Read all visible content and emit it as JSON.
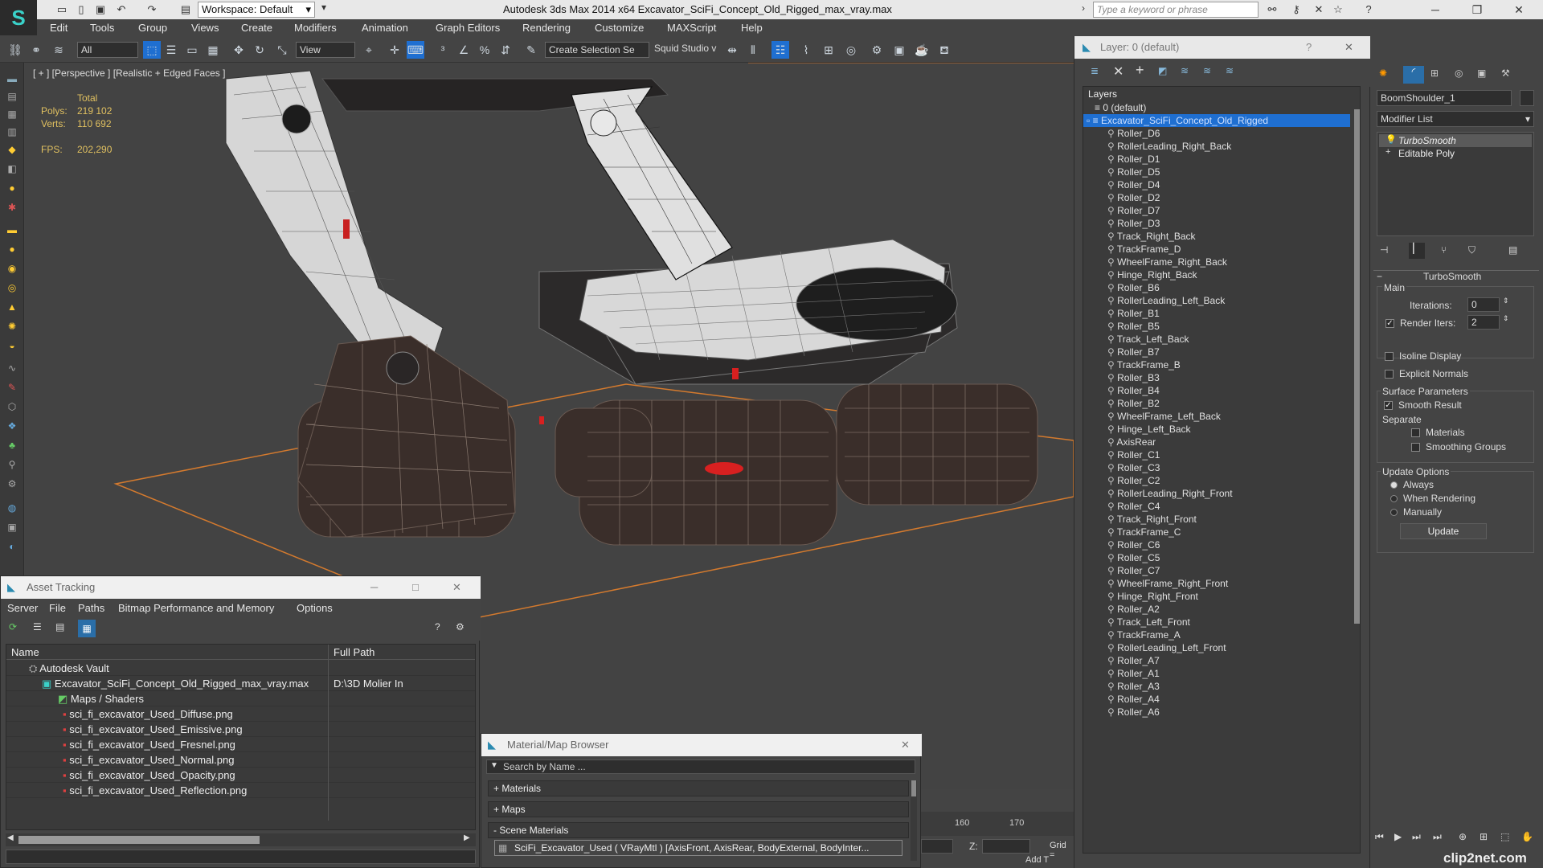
{
  "app": {
    "title": "Autodesk 3ds Max  2014 x64     Excavator_SciFi_Concept_Old_Rigged_max_vray.max",
    "logo_text": "S",
    "workspace": "Workspace: Default",
    "search_placeholder": "Type a keyword or phrase"
  },
  "menu": [
    "Edit",
    "Tools",
    "Group",
    "Views",
    "Create",
    "Modifiers",
    "Animation",
    "Graph Editors",
    "Rendering",
    "Customize",
    "MAXScript",
    "Help"
  ],
  "toolbar": {
    "selection_filter": "All",
    "ref_coord": "View",
    "selection_set_placeholder": "Create Selection Se",
    "squid_studio": "Squid Studio v"
  },
  "viewport": {
    "label": "[ + ] [Perspective ] [Realistic + Edged Faces ]",
    "stats_total": "Total",
    "polys_label": "Polys:",
    "polys_value": "219 102",
    "verts_label": "Verts:",
    "verts_value": "110 692",
    "fps_label": "FPS:",
    "fps_value": "202,290"
  },
  "layers": {
    "title": "Layer: 0 (default)",
    "header": "Layers",
    "default_layer": "0 (default)",
    "selected_layer": "Excavator_SciFi_Concept_Old_Rigged",
    "items": [
      "Roller_D6",
      "RollerLeading_Right_Back",
      "Roller_D1",
      "Roller_D5",
      "Roller_D4",
      "Roller_D2",
      "Roller_D7",
      "Roller_D3",
      "Track_Right_Back",
      "TrackFrame_D",
      "WheelFrame_Right_Back",
      "Hinge_Right_Back",
      "Roller_B6",
      "RollerLeading_Left_Back",
      "Roller_B1",
      "Roller_B5",
      "Track_Left_Back",
      "Roller_B7",
      "TrackFrame_B",
      "Roller_B3",
      "Roller_B4",
      "Roller_B2",
      "WheelFrame_Left_Back",
      "Hinge_Left_Back",
      "AxisRear",
      "Roller_C1",
      "Roller_C3",
      "Roller_C2",
      "RollerLeading_Right_Front",
      "Roller_C4",
      "Track_Right_Front",
      "TrackFrame_C",
      "Roller_C6",
      "Roller_C5",
      "Roller_C7",
      "WheelFrame_Right_Front",
      "Hinge_Right_Front",
      "Roller_A2",
      "Track_Left_Front",
      "TrackFrame_A",
      "RollerLeading_Left_Front",
      "Roller_A7",
      "Roller_A1",
      "Roller_A3",
      "Roller_A4",
      "Roller_A6"
    ]
  },
  "command_panel": {
    "object_name": "BoomShoulder_1",
    "modifier_list": "Modifier List",
    "stack": [
      "TurboSmooth",
      "Editable Poly"
    ],
    "turbosmooth": {
      "title": "TurboSmooth",
      "main": "Main",
      "iterations_label": "Iterations:",
      "iterations_value": "0",
      "render_iters_label": "Render Iters:",
      "render_iters_value": "2",
      "isoline": "Isoline Display",
      "explicit_normals": "Explicit Normals",
      "surface_params": "Surface Parameters",
      "smooth_result": "Smooth Result",
      "separate": "Separate",
      "materials": "Materials",
      "smoothing_groups": "Smoothing Groups",
      "update_options": "Update Options",
      "always": "Always",
      "when_rendering": "When Rendering",
      "manually": "Manually",
      "update_button": "Update"
    }
  },
  "asset_tracking": {
    "title": "Asset Tracking",
    "menu": [
      "Server",
      "File",
      "Paths",
      "Bitmap Performance and Memory",
      "Options"
    ],
    "col_name": "Name",
    "col_path": "Full Path",
    "vault": "Autodesk Vault",
    "max_file": "Excavator_SciFi_Concept_Old_Rigged_max_vray.max",
    "max_file_path": "D:\\3D Molier In",
    "maps_folder": "Maps / Shaders",
    "files": [
      "sci_fi_excavator_Used_Diffuse.png",
      "sci_fi_excavator_Used_Emissive.png",
      "sci_fi_excavator_Used_Fresnel.png",
      "sci_fi_excavator_Used_Normal.png",
      "sci_fi_excavator_Used_Opacity.png",
      "sci_fi_excavator_Used_Reflection.png"
    ]
  },
  "material_browser": {
    "title": "Material/Map Browser",
    "search_placeholder": "Search by Name ...",
    "groups": [
      "+ Materials",
      "+ Maps",
      "- Scene Materials"
    ],
    "scene_material": "SciFi_Excavator_Used  ( VRayMtl ) [AxisFront, AxisRear, BodyExternal, BodyInter..."
  },
  "timeline": {
    "tick_160": "160",
    "tick_170": "170",
    "z_label": "Z:",
    "grid_label": "Grid =",
    "add_t": "Add T"
  },
  "watermark": "clip2net.com"
}
